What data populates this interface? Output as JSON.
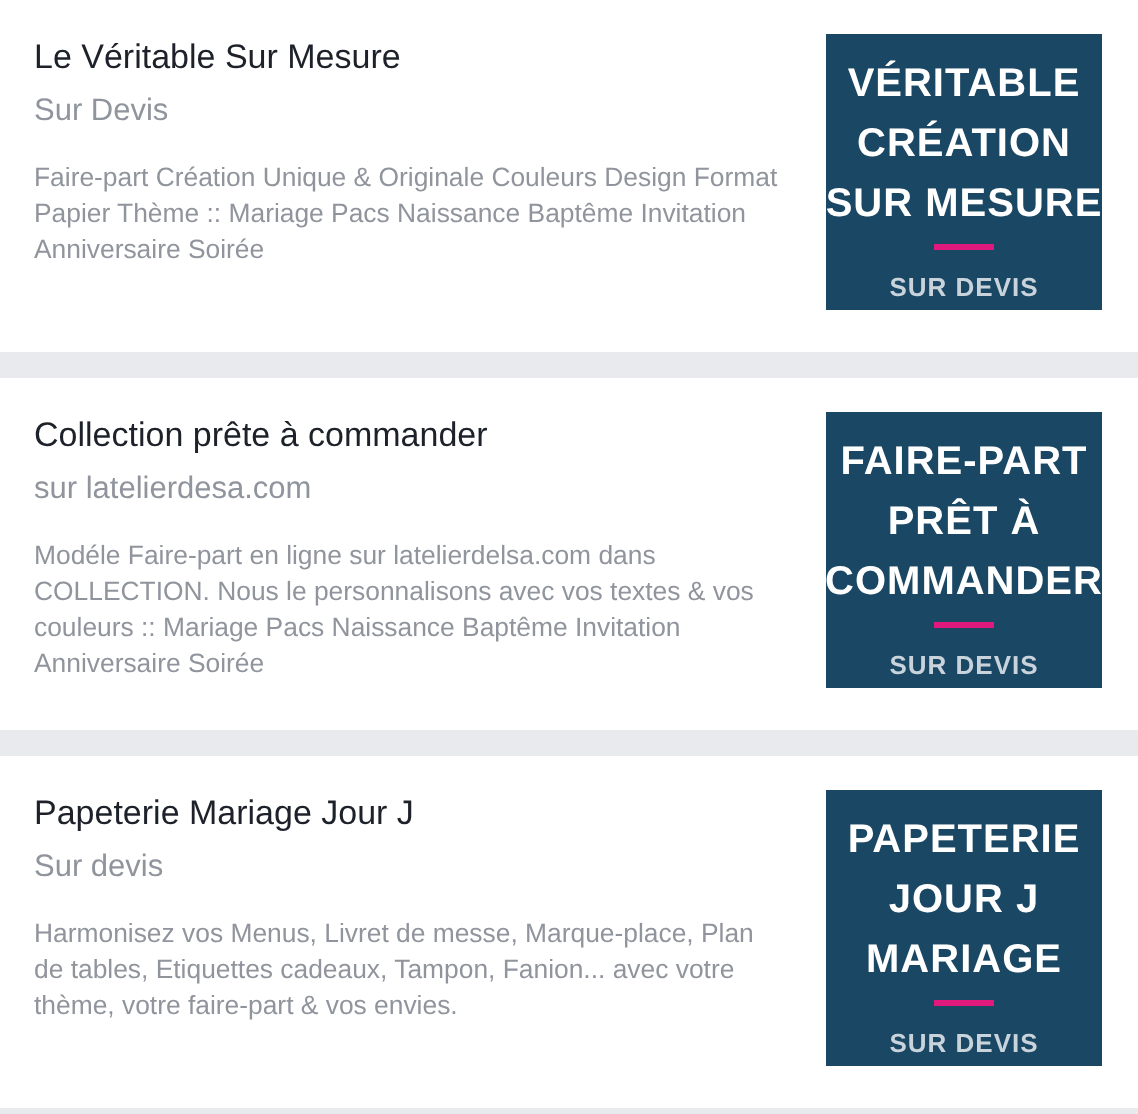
{
  "listings": [
    {
      "title": "Le Véritable Sur Mesure",
      "subtitle": "Sur Devis",
      "description": "Faire-part Création Unique & Originale Couleurs Design Format Papier Thème :: Mariage Pacs Naissance Baptême Invitation Anniversaire Soirée",
      "tile": {
        "lines": [
          "VÉRITABLE",
          "CRÉATION",
          "SUR MESURE"
        ],
        "footer": "SUR DEVIS"
      }
    },
    {
      "title": "Collection prête à commander",
      "subtitle": "sur latelierdesa.com",
      "description": "Modéle Faire-part en ligne sur latelierdelsa.com dans COLLECTION. Nous le personnalisons avec vos textes & vos couleurs :: Mariage Pacs Naissance Baptême Invitation Anniversaire Soirée",
      "tile": {
        "lines": [
          "FAIRE-PART",
          "PRÊT À",
          "COMMANDER"
        ],
        "footer": "SUR DEVIS"
      }
    },
    {
      "title": "Papeterie Mariage Jour J",
      "subtitle": "Sur devis",
      "description": "Harmonisez vos Menus, Livret de messe, Marque-place, Plan de tables, Etiquettes cadeaux, Tampon, Fanion... avec votre thème, votre faire-part & vos envies.",
      "tile": {
        "lines": [
          "PAPETERIE",
          "JOUR J",
          "MARIAGE"
        ],
        "footer": "SUR DEVIS"
      }
    }
  ]
}
